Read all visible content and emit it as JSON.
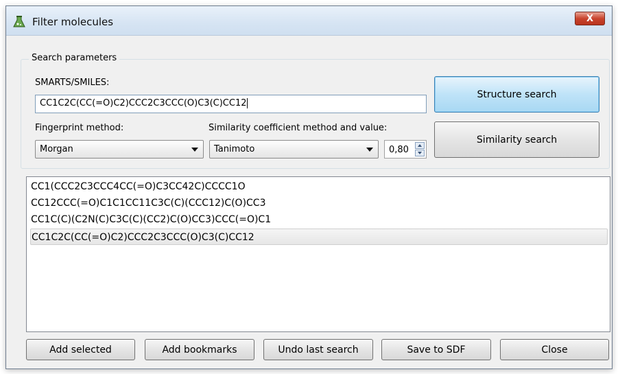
{
  "window": {
    "title": "Filter molecules",
    "close_label": "X"
  },
  "search_parameters": {
    "group_title": "Search parameters",
    "smarts_label": "SMARTS/SMILES:",
    "smarts_value": "CC1C2C(CC(=O)C2)CCC2C3CCC(O)C3(C)CC12",
    "fingerprint_label": "Fingerprint method:",
    "fingerprint_selected": "Morgan",
    "similarity_label": "Similarity coefficient method and value:",
    "similarity_selected": "Tanimoto",
    "similarity_value": "0,80",
    "structure_search_label": "Structure search",
    "similarity_search_label": "Similarity search"
  },
  "results": [
    "CC1(CCC2C3CCC4CC(=O)C3CC42C)CCCC1O",
    "CC12CCC(=O)C1C1CC11C3C(C)(CCC12)C(O)CC3",
    "CC1C(C)(C2N(C)C3C(C)(CC2)C(O)CC3)CCC(=O)C1",
    "CC1C2C(CC(=O)C2)CCC2C3CCC(O)C3(C)CC12"
  ],
  "selected_result_index": 3,
  "buttons": {
    "add_selected": "Add selected",
    "add_bookmarks": "Add bookmarks",
    "undo_last_search": "Undo last search",
    "save_to_sdf": "Save to SDF",
    "close": "Close"
  },
  "colors": {
    "primary_button": "#bfe3f8",
    "close_button": "#c9452e"
  },
  "icons": {
    "app": "flask-icon",
    "close": "close-icon",
    "combo_arrow": "chevron-down-icon"
  }
}
